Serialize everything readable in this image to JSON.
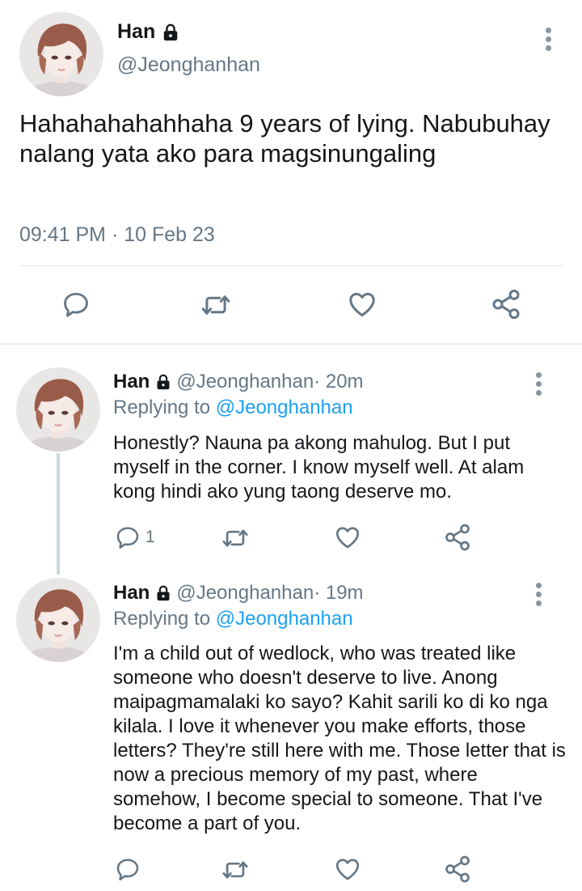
{
  "main_tweet": {
    "name": "Han",
    "handle": "@Jeonghanhan",
    "text": "Hahahahahahhaha 9 years of lying. Nabubuhay nalang yata ako para magsinungaling",
    "timestamp": "09:41 PM · 10 Feb 23",
    "icons": [
      "lock-icon",
      "more-vertical-icon",
      "reply-icon",
      "retweet-icon",
      "like-icon",
      "share-icon"
    ]
  },
  "replies": [
    {
      "name": "Han",
      "handle": "@Jeonghanhan",
      "time": " · 20m",
      "replying_label": "Replying to ",
      "replying_to": "@Jeonghanhan",
      "text": "Honestly? Nauna pa akong mahulog. But I put myself in the corner. I know myself well. At alam kong hindi ako yung taong deserve mo.",
      "reply_count": "1"
    },
    {
      "name": "Han",
      "handle": "@Jeonghanhan",
      "time": " · 19m",
      "replying_label": "Replying to ",
      "replying_to": "@Jeonghanhan",
      "text": "I'm a child out of wedlock, who was treated like someone who doesn't deserve to live. Anong maipagmamalaki ko sayo? Kahit sarili ko di ko nga kilala. I love it whenever you make efforts, those letters? They're still here with me. Those letter that is now a precious memory of my past, where somehow, I become special to someone. That I've become a part of you.",
      "reply_count": ""
    }
  ],
  "colors": {
    "accent": "#1da1f2",
    "muted": "#657786",
    "divider": "#e6ecf0"
  }
}
